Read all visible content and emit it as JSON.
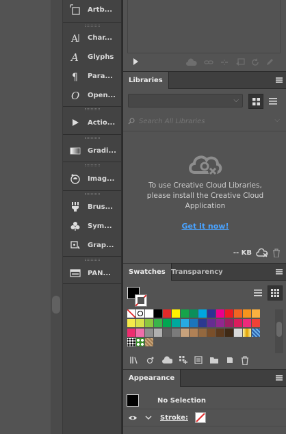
{
  "dock": {
    "items": [
      {
        "label": "Artb...",
        "icon": "artboards-icon"
      },
      {
        "label": "Char...",
        "icon": "character-icon"
      },
      {
        "label": "Glyphs",
        "icon": "glyphs-icon"
      },
      {
        "label": "Para...",
        "icon": "paragraph-icon"
      },
      {
        "label": "Open...",
        "icon": "opentype-icon"
      },
      {
        "label": "Actio...",
        "icon": "actions-play-icon"
      },
      {
        "label": "Gradi...",
        "icon": "gradient-icon"
      },
      {
        "label": "Imag...",
        "icon": "image-trace-icon"
      },
      {
        "label": "Brus...",
        "icon": "brushes-icon"
      },
      {
        "label": "Sym...",
        "icon": "symbols-icon"
      },
      {
        "label": "Grap...",
        "icon": "graphic-styles-icon"
      },
      {
        "label": "PAN...",
        "icon": "panel-icon"
      }
    ]
  },
  "libraries": {
    "tab": "Libraries",
    "search_placeholder": "Search All Libraries",
    "message": "To use Creative Cloud Libraries, please install the Creative Cloud Application",
    "cta": "Get it now!",
    "storage": "-- KB"
  },
  "swatches": {
    "tabs": [
      "Swatches",
      "Transparency"
    ],
    "rows": [
      [
        "none",
        "reg",
        "#ffffff",
        "#000000",
        "#e02a2a",
        "#fff200",
        "#16a34a",
        "#0b8f5a",
        "#00a6e0",
        "#2e3192",
        "#ec008c",
        "#ed1c24",
        "#f26522",
        "#f7941d",
        "#fbb040"
      ],
      [
        "#f5e94a",
        "#d7e04b",
        "#8cc63f",
        "#39b54a",
        "#00a651",
        "#00a99d",
        "#27aae1",
        "#1c75bc",
        "#2b3990",
        "#662d91",
        "#92278f",
        "#9e1f63",
        "#da1c5c",
        "#ee2a7b",
        "#ef4136"
      ],
      [
        "#ed2d6f",
        "#f06eaa",
        "#8f8f8f",
        "#b0b0b0",
        "#5e5e5e",
        "#7b7b7b",
        "#c7a27c",
        "#b08156",
        "#93683f",
        "#7a4f2a",
        "#5c3a1e",
        "#3f2a16",
        "#d9d9d9",
        "grad-gold",
        "grad-blue"
      ],
      [
        "pattern-dots",
        "pattern-leaf",
        "pattern-fabric"
      ]
    ]
  },
  "appearance": {
    "tab": "Appearance",
    "selection": "No Selection",
    "stroke_label": "Stroke:"
  }
}
